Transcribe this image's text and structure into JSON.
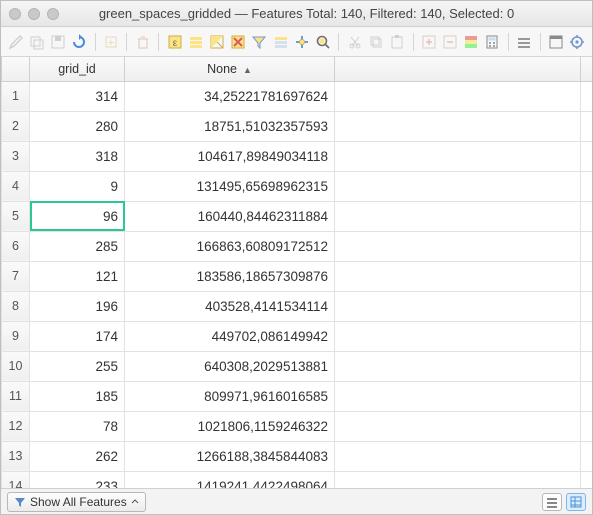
{
  "titlebar": {
    "layer": "green_spaces_gridded",
    "sep": " — ",
    "features_label": "Features Total: ",
    "features_total": "140",
    "filtered_label": ", Filtered: ",
    "filtered": "140",
    "selected_label": ", Selected: ",
    "selected": "0"
  },
  "columns": {
    "rownum": "",
    "c1": "grid_id",
    "c2": "None"
  },
  "rows": [
    {
      "n": "1",
      "grid_id": "314",
      "val": "34,25221781697624",
      "sel": false
    },
    {
      "n": "2",
      "grid_id": "280",
      "val": "18751,51032357593",
      "sel": false
    },
    {
      "n": "3",
      "grid_id": "318",
      "val": "104617,89849034118",
      "sel": false
    },
    {
      "n": "4",
      "grid_id": "9",
      "val": "131495,65698962315",
      "sel": false
    },
    {
      "n": "5",
      "grid_id": "96",
      "val": "160440,84462311884",
      "sel": true
    },
    {
      "n": "6",
      "grid_id": "285",
      "val": "166863,60809172512",
      "sel": false
    },
    {
      "n": "7",
      "grid_id": "121",
      "val": "183586,18657309876",
      "sel": false
    },
    {
      "n": "8",
      "grid_id": "196",
      "val": "403528,4141534114",
      "sel": false
    },
    {
      "n": "9",
      "grid_id": "174",
      "val": "449702,086149942",
      "sel": false
    },
    {
      "n": "10",
      "grid_id": "255",
      "val": "640308,2029513881",
      "sel": false
    },
    {
      "n": "11",
      "grid_id": "185",
      "val": "809971,9616016585",
      "sel": false
    },
    {
      "n": "12",
      "grid_id": "78",
      "val": "1021806,1159246322",
      "sel": false
    },
    {
      "n": "13",
      "grid_id": "262",
      "val": "1266188,3845844083",
      "sel": false
    },
    {
      "n": "14",
      "grid_id": "233",
      "val": "1419241,4422498064",
      "sel": false
    }
  ],
  "statusbar": {
    "filter_label": "Show All Features"
  }
}
